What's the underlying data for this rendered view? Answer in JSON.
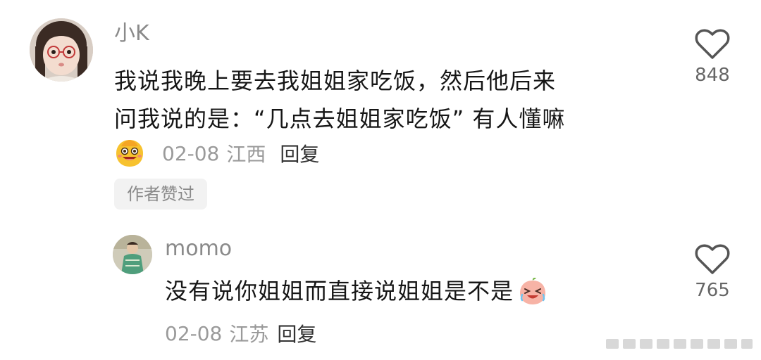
{
  "comment": {
    "username": "小K",
    "text_line1": "我说我晚上要去我姐姐家吃饭，然后他后来",
    "text_line2": "问我说的是：“几点去姐姐家吃饭” 有人懂嘛",
    "emoji_icon": "laughing-face-icon",
    "date": "02-08",
    "location": "江西",
    "reply_label": "回复",
    "author_liked_label": "作者赞过",
    "like_icon": "heart-outline-icon",
    "like_count": "848"
  },
  "reply": {
    "username": "momo",
    "text": "没有说你姐姐而直接说姐姐是不是",
    "emoji_icon": "peach-crying-laughing-icon",
    "date": "02-08",
    "location": "江苏",
    "reply_label": "回复",
    "like_icon": "heart-outline-icon",
    "like_count": "765"
  },
  "colors": {
    "primary_text": "#161616",
    "secondary_text": "#9a9a9a",
    "username": "#8a8a8a",
    "badge_background": "#f2f2f2"
  }
}
